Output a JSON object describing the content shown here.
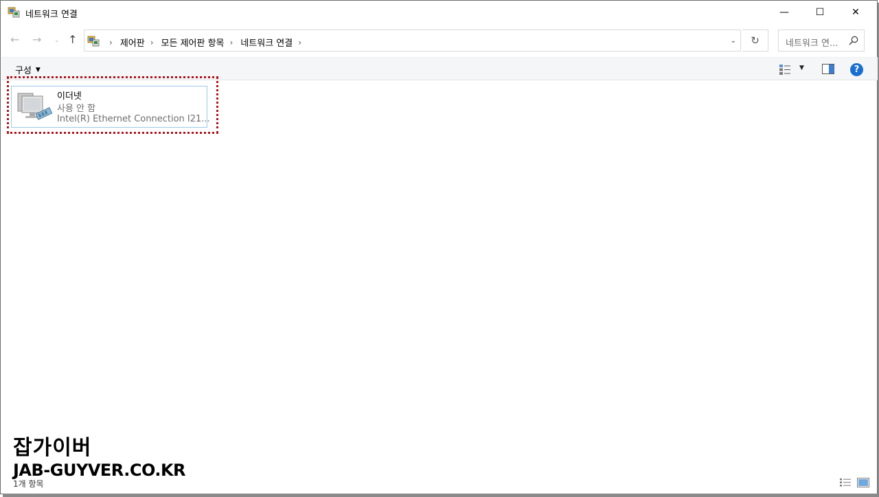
{
  "window": {
    "title": "네트워크 연결",
    "buttons": {
      "minimize": "—",
      "maximize": "☐",
      "close": "✕"
    }
  },
  "nav": {
    "back_icon": "←",
    "forward_icon": "→",
    "recent_icon": "⌄",
    "up_icon": "↑",
    "breadcrumb": [
      "제어판",
      "모든 제어판 항목",
      "네트워크 연결"
    ],
    "separator": "›",
    "dropdown_icon": "⌄",
    "refresh_icon": "↻",
    "search_placeholder": "네트워크 연..."
  },
  "command_bar": {
    "organize_label": "구성",
    "organize_caret": "▼",
    "view_caret": "▼",
    "help_label": "?"
  },
  "items": [
    {
      "name": "이더넷",
      "status": "사용 안 함",
      "device": "Intel(R) Ethernet Connection I21..."
    }
  ],
  "watermark": {
    "line1": "잡가이버",
    "line2": "JAB-GUYVER.CO.KR"
  },
  "status_bar": {
    "item_count": "1개 항목"
  },
  "colors": {
    "highlight": "#b3131b",
    "selection_border": "#99c9e6",
    "help_blue": "#1a6fd1"
  }
}
